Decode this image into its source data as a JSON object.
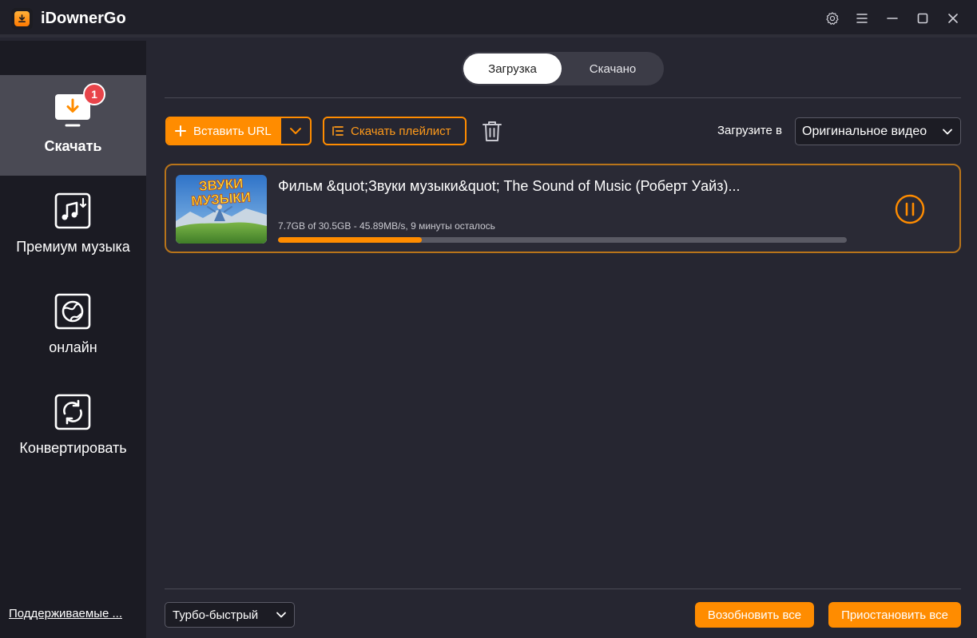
{
  "app": {
    "title": "iDownerGo"
  },
  "sidebar": {
    "items": [
      {
        "label": "Скачать",
        "icon": "download-monitor-icon",
        "badge": "1",
        "active": true
      },
      {
        "label": "Премиум музыка",
        "icon": "music-download-icon",
        "active": false
      },
      {
        "label": "онлайн",
        "icon": "globe-icon",
        "active": false
      },
      {
        "label": "Конвертировать",
        "icon": "convert-icon",
        "active": false
      }
    ],
    "supported_link": "Поддерживаемые ..."
  },
  "tabs": {
    "downloading": "Загрузка",
    "downloaded": "Скачано"
  },
  "toolbar": {
    "paste_url": "Вставить URL",
    "download_playlist": "Скачать плейлист",
    "format_label": "Загрузите в",
    "format_value": "Оригинальное видео"
  },
  "download": {
    "title": "Фильм &quot;Звуки музыки&quot; The Sound of Music (Роберт Уайз)...",
    "stats": "7.7GB of 30.5GB -   45.89MB/s, 9 минуты осталось",
    "thumbnail_text_line1": "ЗВУКИ",
    "thumbnail_text_line2": "МУЗЫКИ",
    "progress_fraction": 0.2525
  },
  "footer": {
    "speed_value": "Турбо-быстрый",
    "resume_all": "Возобновить все",
    "pause_all": "Приостановить все"
  },
  "colors": {
    "accent": "#ff8c00",
    "background": "#262631",
    "sidebar": "#1b1b23",
    "badge": "#e8444a"
  }
}
